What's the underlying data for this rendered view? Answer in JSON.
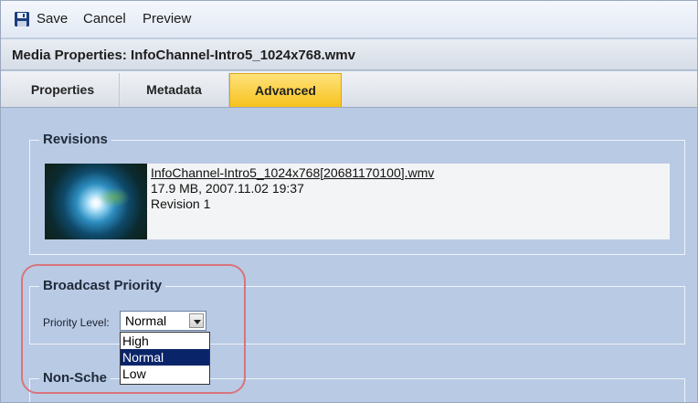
{
  "toolbar": {
    "save_label": "Save",
    "cancel_label": "Cancel",
    "preview_label": "Preview"
  },
  "window": {
    "title": "Media Properties: InfoChannel-Intro5_1024x768.wmv"
  },
  "tabs": [
    {
      "label": "Properties",
      "active": false
    },
    {
      "label": "Metadata",
      "active": false
    },
    {
      "label": "Advanced",
      "active": true
    }
  ],
  "revisions": {
    "legend": "Revisions",
    "items": [
      {
        "filename": "InfoChannel-Intro5_1024x768[20681170100].wmv",
        "details": "17.9 MB, 2007.11.02 19:37",
        "revision": "Revision 1"
      }
    ]
  },
  "broadcast_priority": {
    "legend": "Broadcast Priority",
    "priority_label": "Priority Level:",
    "selected": "Normal",
    "options": [
      "High",
      "Normal",
      "Low"
    ]
  },
  "non_scheduled": {
    "legend": "Non-Sche"
  },
  "colors": {
    "content_bg": "#b9cae4",
    "active_tab": "#f6c21e",
    "selected_option_bg": "#0a246a",
    "highlight_ring": "#d8747c"
  }
}
